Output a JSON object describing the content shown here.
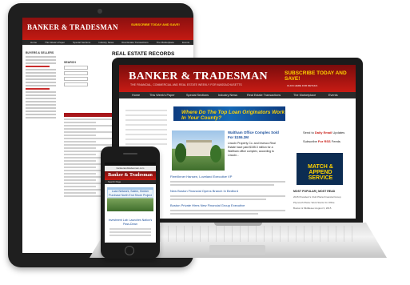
{
  "tablet": {
    "logo": "BANKER & TRADESMAN",
    "promo": "SUBSCRIBE TODAY AND SAVE!",
    "nav": [
      "Home",
      "This Week's Paper",
      "Special Sections",
      "Industry News",
      "Real Estate Transactions",
      "The Marketplace",
      "Events"
    ],
    "sidebar_heading": "BUYERS & SELLERS",
    "page_title": "REAL ESTATE RECORDS",
    "form_heading": "SEARCH"
  },
  "laptop": {
    "logo": "BANKER & TRADESMAN",
    "tagline": "THE FINANCIAL, COMMERCIAL AND REAL ESTATE WEEKLY FOR MASSACHUSETTS",
    "promo_line1": "SUBSCRIBE TODAY AND SAVE!",
    "promo_line2": "CLICK HERE FOR DETAILS",
    "nav": [
      "Home",
      "This Week's Paper",
      "Special Sections",
      "Industry News",
      "Real Estate Transactions",
      "The Marketplace",
      "Events"
    ],
    "banner_text": "Where Do The Top Loan Originators Work In Your County?",
    "featured_title": "Waltham Office Complex Sold For $155.3M",
    "featured_body": "Lincoln Property Co. and Invesco Real Estate have paid $155.3 million for a Waltham office complex, according to Lincoln...",
    "headlines": [
      "Fleet/Inner Hansen, Loveland Executive VP",
      "New Boston Financial Opens Branch In Bedford",
      "Boston Private Hires New Financial Group Executive"
    ],
    "right_items": [
      {
        "prefix": "Send to ",
        "bold": "Daily Email",
        "suffix": " Updates"
      },
      {
        "prefix": "Subscribe ",
        "bold": "For RSS",
        "suffix": " Feeds"
      }
    ],
    "ad_text": "MATCH & APPEND SERVICE",
    "most_popular_heading": "MOST POPULAR | MOST READ",
    "most_popular": [
      "2015 President's Club Plaza Financial Group",
      "Plymouth Plaza: Work Starts On Office",
      "Boston & Middlesex August 3, 2015"
    ]
  },
  "phone": {
    "url": "bankerandtradesman.com",
    "logo": "Banker & Tradesman",
    "nav": "Search Page",
    "caption": "Loan Network, Salem, Kimber Purchase North End Shore Project",
    "link": "Investment Lab: Launches Nation's Pass-Down"
  }
}
